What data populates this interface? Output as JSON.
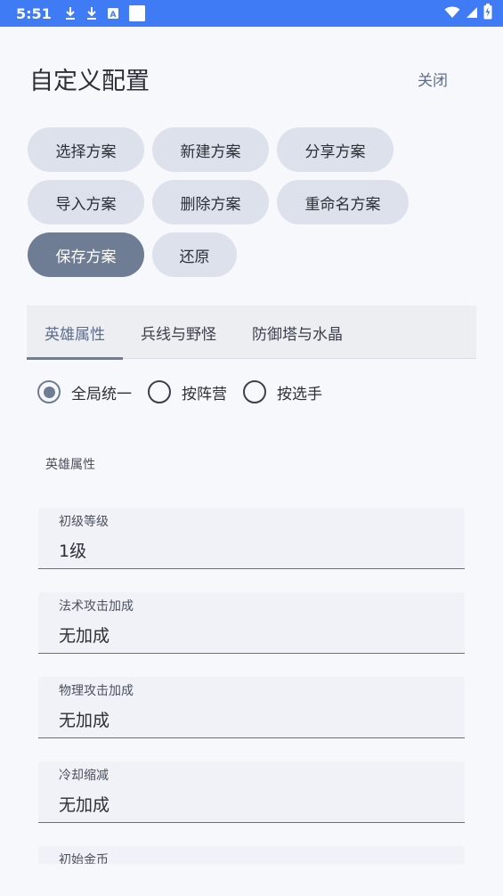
{
  "status_bar": {
    "time": "5:51",
    "icons": [
      "download-icon",
      "download-icon",
      "a-box-icon",
      "white-square-icon"
    ],
    "right_icons": [
      "wifi-icon",
      "signal-icon",
      "battery-charging-icon"
    ]
  },
  "header": {
    "title": "自定义配置",
    "close_label": "关闭"
  },
  "chips": {
    "row1": [
      "选择方案",
      "新建方案",
      "分享方案"
    ],
    "row2": [
      "导入方案",
      "删除方案",
      "重命名方案"
    ],
    "row3": [
      "保存方案",
      "还原"
    ],
    "active": "保存方案"
  },
  "tabs": {
    "items": [
      "英雄属性",
      "兵线与野怪",
      "防御塔与水晶"
    ],
    "active": "英雄属性"
  },
  "scope_options": {
    "items": [
      "全局统一",
      "按阵营",
      "按选手"
    ],
    "selected": "全局统一"
  },
  "section": {
    "label": "英雄属性"
  },
  "fields": [
    {
      "label": "初级等级",
      "value": "1级"
    },
    {
      "label": "法术攻击加成",
      "value": "无加成"
    },
    {
      "label": "物理攻击加成",
      "value": "无加成"
    },
    {
      "label": "冷却缩减",
      "value": "无加成"
    },
    {
      "label": "初始金币",
      "value": ""
    }
  ],
  "colors": {
    "status_bar": "#3f7bf5",
    "accent": "#6f7d94",
    "chip_bg": "#dce1ec"
  }
}
